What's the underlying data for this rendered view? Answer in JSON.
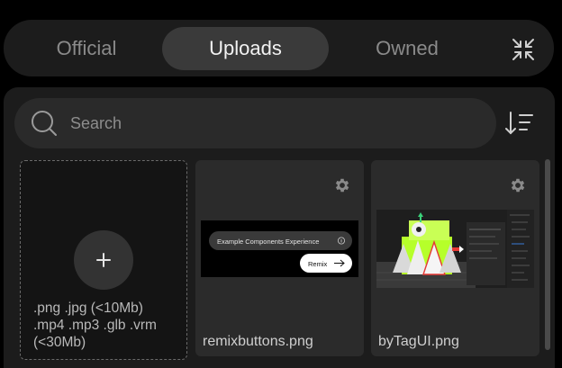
{
  "tabs": {
    "official": "Official",
    "uploads": "Uploads",
    "owned": "Owned"
  },
  "active_tab": "Uploads",
  "close_icon": "collapse-arrows-icon",
  "search": {
    "placeholder": "Search",
    "icon": "search-icon"
  },
  "sort_icon": "sort-descending-icon",
  "upload": {
    "icon": "plus-icon",
    "formats_line1": ".png .jpg (<10Mb)",
    "formats_line2": ".mp4 .mp3 .glb .vrm",
    "formats_line3": "(<30Mb)"
  },
  "assets": [
    {
      "name": "remixbuttons.png",
      "thumb_pill": "Example Components Experience",
      "thumb_button": "Remix"
    },
    {
      "name": "byTagUI.png"
    }
  ],
  "colors": {
    "background": "#000000",
    "surface": "#1c1c1c",
    "active_tab": "#3a3a3a",
    "card": "#2b2b2b",
    "accent_green": "#b6ff2a",
    "accent_red": "#e53935"
  }
}
